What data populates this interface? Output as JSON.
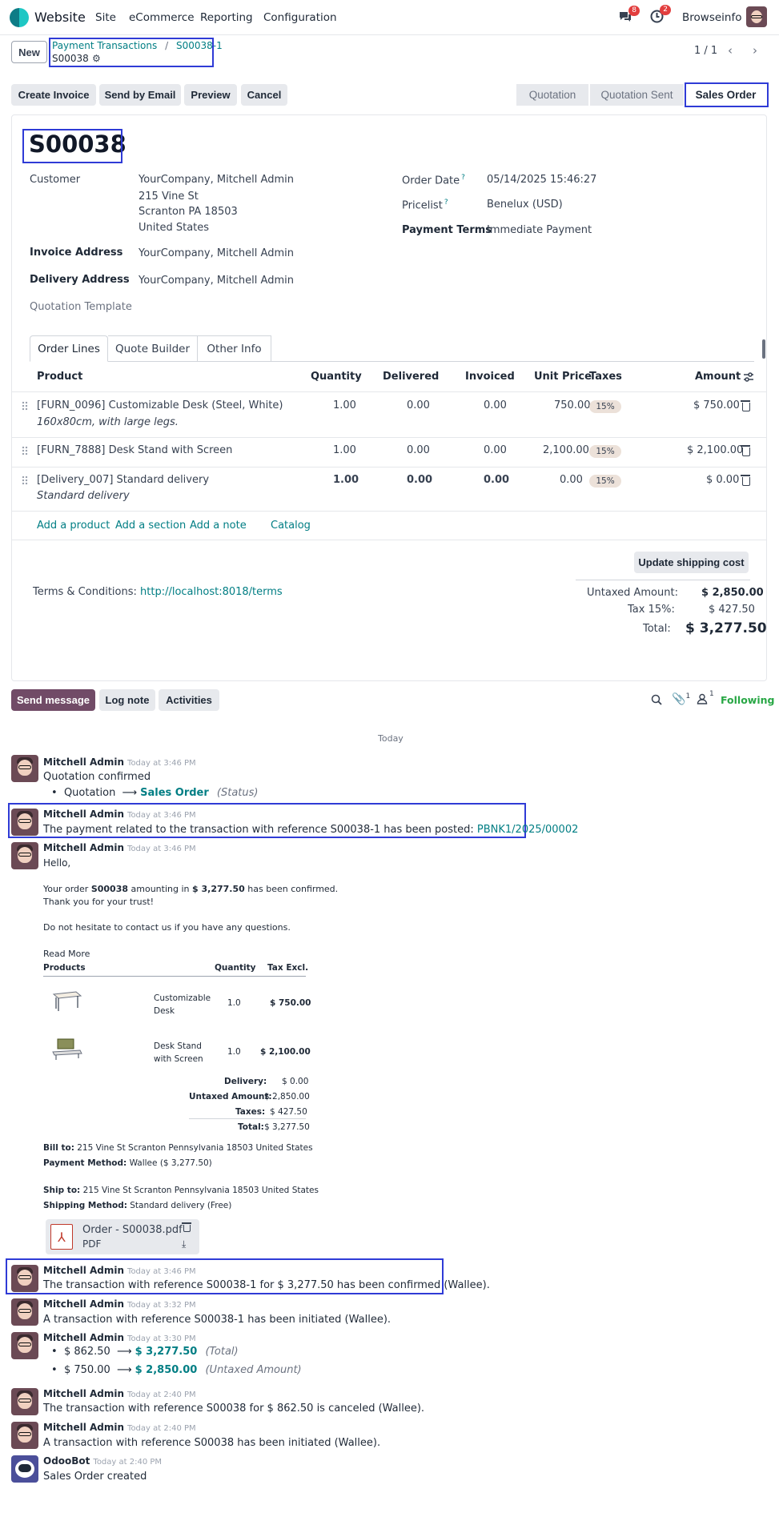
{
  "navbar": {
    "app_name": "Website",
    "menu": [
      "Site",
      "eCommerce",
      "Reporting",
      "Configuration"
    ],
    "messages_badge": "8",
    "activities_badge": "2",
    "company": "Browseinfo"
  },
  "control": {
    "new_label": "New",
    "breadcrumb_parent": "Payment Transactions",
    "breadcrumb_sep": "/",
    "breadcrumb_current": "S00038-1",
    "record_name": "S00038",
    "pager": "1 / 1"
  },
  "actions": {
    "create_invoice": "Create Invoice",
    "send_email": "Send by Email",
    "preview": "Preview",
    "cancel": "Cancel"
  },
  "status": {
    "steps": [
      "Quotation",
      "Quotation Sent",
      "Sales Order"
    ],
    "active": "Sales Order"
  },
  "form": {
    "title": "S00038",
    "customer_label": "Customer",
    "customer_name": "YourCompany, Mitchell Admin",
    "address_line1": "215 Vine St",
    "address_line2": "Scranton PA 18503",
    "address_line3": "United States",
    "invoice_address_label": "Invoice Address",
    "invoice_address": "YourCompany, Mitchell Admin",
    "delivery_address_label": "Delivery Address",
    "delivery_address": "YourCompany, Mitchell Admin",
    "quotation_template_label": "Quotation Template",
    "order_date_label": "Order Date",
    "order_date": "05/14/2025 15:46:27",
    "pricelist_label": "Pricelist",
    "pricelist": "Benelux (USD)",
    "payment_terms_label": "Payment Terms",
    "payment_terms": "Immediate Payment",
    "help_mark": "?"
  },
  "tabs": [
    "Order Lines",
    "Quote Builder",
    "Other Info"
  ],
  "table": {
    "headers": [
      "Product",
      "Quantity",
      "Delivered",
      "Invoiced",
      "Unit Price",
      "Taxes",
      "Amount"
    ],
    "rows": [
      {
        "product": "[FURN_0096] Customizable Desk (Steel, White)",
        "desc": "160x80cm, with large legs.",
        "qty": "1.00",
        "delivered": "0.00",
        "invoiced": "0.00",
        "price": "750.00",
        "tax": "15%",
        "amount": "$ 750.00"
      },
      {
        "product": "[FURN_7888] Desk Stand with Screen",
        "desc": "",
        "qty": "1.00",
        "delivered": "0.00",
        "invoiced": "0.00",
        "price": "2,100.00",
        "tax": "15%",
        "amount": "$ 2,100.00"
      },
      {
        "product": "[Delivery_007] Standard delivery",
        "desc": "Standard delivery",
        "qty": "1.00",
        "delivered": "0.00",
        "invoiced": "0.00",
        "price": "0.00",
        "tax": "15%",
        "amount": "$ 0.00"
      }
    ],
    "add_product": "Add a product",
    "add_section": "Add a section",
    "add_note": "Add a note",
    "catalog": "Catalog"
  },
  "totals": {
    "update_shipping": "Update shipping cost",
    "terms_label": "Terms & Conditions:",
    "terms_link": "http://localhost:8018/terms",
    "untaxed_label": "Untaxed Amount:",
    "untaxed": "$ 2,850.00",
    "tax_label": "Tax 15%:",
    "tax": "$ 427.50",
    "total_label": "Total:",
    "total": "$ 3,277.50"
  },
  "chatter": {
    "send_message": "Send message",
    "log_note": "Log note",
    "activities": "Activities",
    "attachments_count": "1",
    "followers_count": "1",
    "following": "Following",
    "today": "Today",
    "messages": [
      {
        "author": "Mitchell Admin",
        "time": "Today at 3:46 PM",
        "body": "Quotation confirmed",
        "change_from": "Quotation",
        "change_to": "Sales Order",
        "change_field": "(Status)"
      },
      {
        "author": "Mitchell Admin",
        "time": "Today at 3:46 PM",
        "body": "The payment related to the transaction with reference S00038-1 has been posted:",
        "link": "PBNK1/2025/00002"
      },
      {
        "author": "Mitchell Admin",
        "time": "Today at 3:46 PM"
      },
      {
        "author": "Mitchell Admin",
        "time": "Today at 3:46 PM",
        "body": "The transaction with reference S00038-1 for $ 3,277.50 has been confirmed (Wallee)."
      },
      {
        "author": "Mitchell Admin",
        "time": "Today at 3:32 PM",
        "body": "A transaction with reference S00038-1 has been initiated (Wallee)."
      },
      {
        "author": "Mitchell Admin",
        "time": "Today at 3:30 PM",
        "change1_from": "$ 862.50",
        "change1_to": "$ 3,277.50",
        "change1_field": "(Total)",
        "change2_from": "$ 750.00",
        "change2_to": "$ 2,850.00",
        "change2_field": "(Untaxed Amount)"
      },
      {
        "author": "Mitchell Admin",
        "time": "Today at 2:40 PM",
        "body": "The transaction with reference S00038 for $ 862.50 is canceled (Wallee)."
      },
      {
        "author": "Mitchell Admin",
        "time": "Today at 2:40 PM",
        "body": "A transaction with reference S00038 has been initiated (Wallee)."
      },
      {
        "author": "OdooBot",
        "time": "Today at 2:40 PM",
        "body": "Sales Order created"
      }
    ]
  },
  "email": {
    "hello": "Hello,",
    "order_prefix": "Your order",
    "order_ref": "S00038",
    "amount_prefix": "amounting in",
    "amount": "$ 3,277.50",
    "confirmed_suffix": "has been confirmed.",
    "thanks": "Thank you for your trust!",
    "contact": "Do not hesitate to contact us if you have any questions.",
    "read_more": "Read More",
    "col_products": "Products",
    "col_quantity": "Quantity",
    "col_tax_excl": "Tax Excl.",
    "items": [
      {
        "name1": "Customizable",
        "name2": "Desk",
        "qty": "1.0",
        "price": "$ 750.00"
      },
      {
        "name1": "Desk Stand",
        "name2": "with Screen",
        "qty": "1.0",
        "price": "$ 2,100.00"
      }
    ],
    "delivery_label": "Delivery:",
    "delivery": "$ 0.00",
    "untaxed_label": "Untaxed Amount:",
    "untaxed": "$ 2,850.00",
    "taxes_label": "Taxes:",
    "taxes": "$ 427.50",
    "total_label": "Total:",
    "total": "$ 3,277.50",
    "bill_to_label": "Bill to:",
    "bill_to": "215 Vine St Scranton Pennsylvania 18503 United States",
    "payment_method_label": "Payment Method:",
    "payment_method": "Wallee ($ 3,277.50)",
    "ship_to_label": "Ship to:",
    "ship_to": "215 Vine St Scranton Pennsylvania 18503 United States",
    "shipping_method_label": "Shipping Method:",
    "shipping_method": "Standard delivery (Free)",
    "attachment_name": "Order - S00038.pdf",
    "attachment_type": "PDF"
  }
}
